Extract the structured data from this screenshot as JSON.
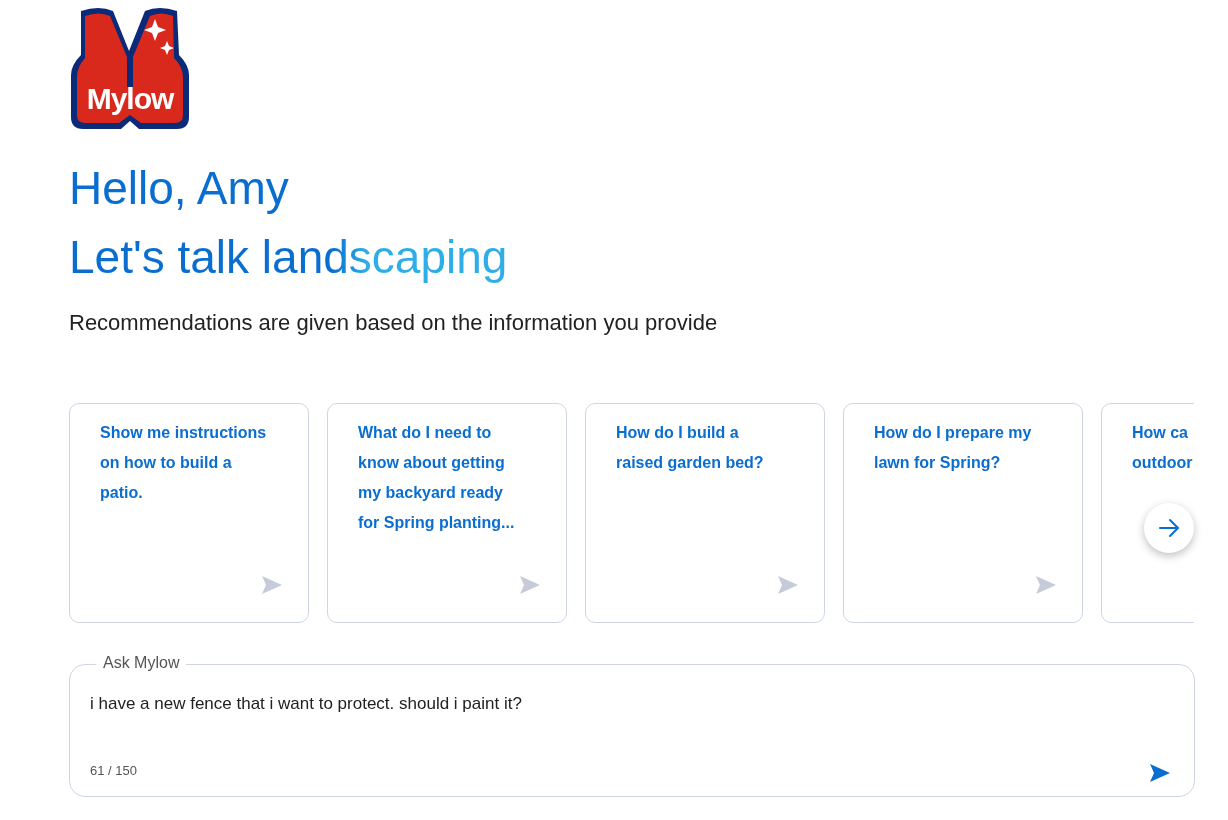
{
  "logo": {
    "text": "Mylow"
  },
  "greeting": "Hello, Amy",
  "headline": "Let's talk landscaping",
  "subtitle": "Recommendations are given based on the information you provide",
  "suggestions": [
    {
      "lines": [
        "Show me instructions",
        "on how to build a",
        "patio."
      ]
    },
    {
      "lines": [
        "What do I need to",
        "know about getting",
        "my backyard ready",
        "for Spring planting..."
      ]
    },
    {
      "lines": [
        "How do I build a",
        "raised garden bed?"
      ]
    },
    {
      "lines": [
        "How do I prepare my",
        "lawn for Spring?"
      ]
    },
    {
      "lines": [
        "How ca",
        "outdoor"
      ]
    }
  ],
  "ask": {
    "label": "Ask Mylow",
    "value": "i have a new fence that i want to protect. should i paint it?",
    "counter": "61 / 150"
  }
}
